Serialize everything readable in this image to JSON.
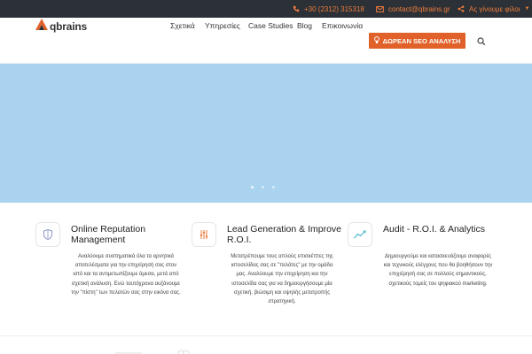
{
  "topbar": {
    "phone": "+30 (2312) 315318",
    "email": "contact@qbrains.gr",
    "social": "Ας γίνουμε φίλοι",
    "phone_icon": "phone-icon",
    "email_icon": "envelope-icon",
    "social_icon": "share-icon"
  },
  "logo": {
    "text": "qbrains"
  },
  "nav": {
    "items": [
      "Σχετικά",
      "Υπηρεσίες",
      "Case Studies",
      "Blog",
      "Επικοινωνία"
    ],
    "cta": "ΔΩΡΕΑΝ SEO ΑΝΑΛΥΣΗ",
    "cta_icon": "lightbulb-icon",
    "search_icon": "search-icon"
  },
  "slider": {
    "dots": 3,
    "active": 0
  },
  "features": [
    {
      "icon": "shield-icon",
      "title": "Online Reputation Management",
      "text": "Αναλύουμε συστηματικά όλα τα αρνητικά αποτελέσματα για την επιχείρησή σας στον ιστό και τα αντιμετωπίζουμε άμεσα, μετά από σχετική ανάλυση. Ενώ ταυτόχρονα αυξάνουμε την \"πίστη\" των πελατών σας στην εικόνα σας."
    },
    {
      "icon": "settings-sliders-icon",
      "title": "Lead Generation & Improve R.O.I.",
      "text": "Μετατρέπουμε τους απλούς επισκέπτες της ιστοσελίδας σας σε \"πελάτες\" με την ομάδα μας. Αναλύουμε την επιχείρηση και την ιστοσελίδα σας για να δημιουργήσουμε μία σχετική, βιώσιμη και υψηλής μετατροπής στρατηγική."
    },
    {
      "icon": "line-chart-icon",
      "title": "Audit - R.O.I. & Analytics",
      "text": "Δημιουργούμε και κατασκευάζουμε αναφορές και τεχνικούς ελέγχους που θα βοηθήσουν την επιχείρησή σας σε πολλούς σημαντικούς, σχετικούς τομείς του ψηφιακού marketing."
    }
  ],
  "colors": {
    "topbar_bg": "#2b3136",
    "accent": "#ee7b3e",
    "cta_bg": "#e0612a",
    "hero_bg": "#a9d3ee"
  }
}
